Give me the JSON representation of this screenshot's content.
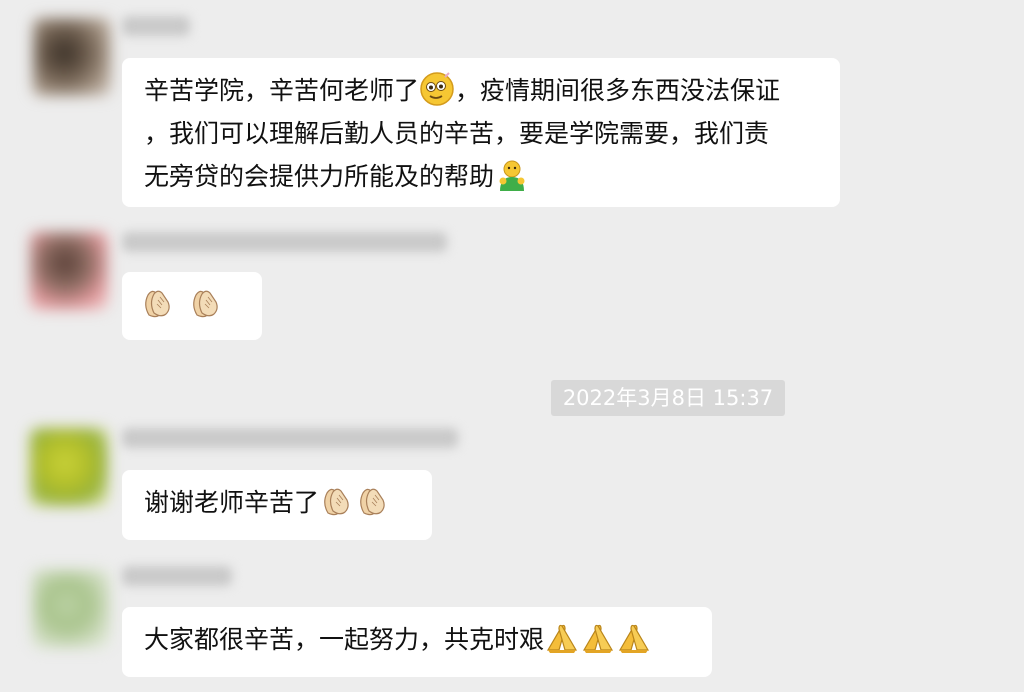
{
  "timestamp": "2022年3月8日 15:37",
  "messages": [
    {
      "lines": [
        "辛苦学院，辛苦何老师了",
        "，我们可以理解后勤人员的辛苦，要是学院需要，我们责",
        "无旁贷的会提供力所能及的帮助"
      ],
      "emojis": [
        "yellow-face-emoji",
        "fist-bump-emoji"
      ]
    },
    {
      "lines": [
        ""
      ],
      "emojis": [
        "clapping-hands-emoji",
        "clapping-hands-emoji"
      ]
    },
    {
      "lines": [
        "谢谢老师辛苦了"
      ],
      "emojis": [
        "clapping-hands-emoji",
        "clapping-hands-emoji"
      ]
    },
    {
      "lines": [
        "大家都很辛苦，一起努力，共克时艰"
      ],
      "emojis": [
        "praying-hands-emoji",
        "praying-hands-emoji",
        "praying-hands-emoji"
      ]
    },
    {
      "lines": [
        "，疫情期间很多东西没法保证"
      ]
    }
  ],
  "colors": {
    "background": "#ededed",
    "bubble": "#ffffff",
    "text": "#111111",
    "timestamp_bg": "#d8d8d8"
  }
}
